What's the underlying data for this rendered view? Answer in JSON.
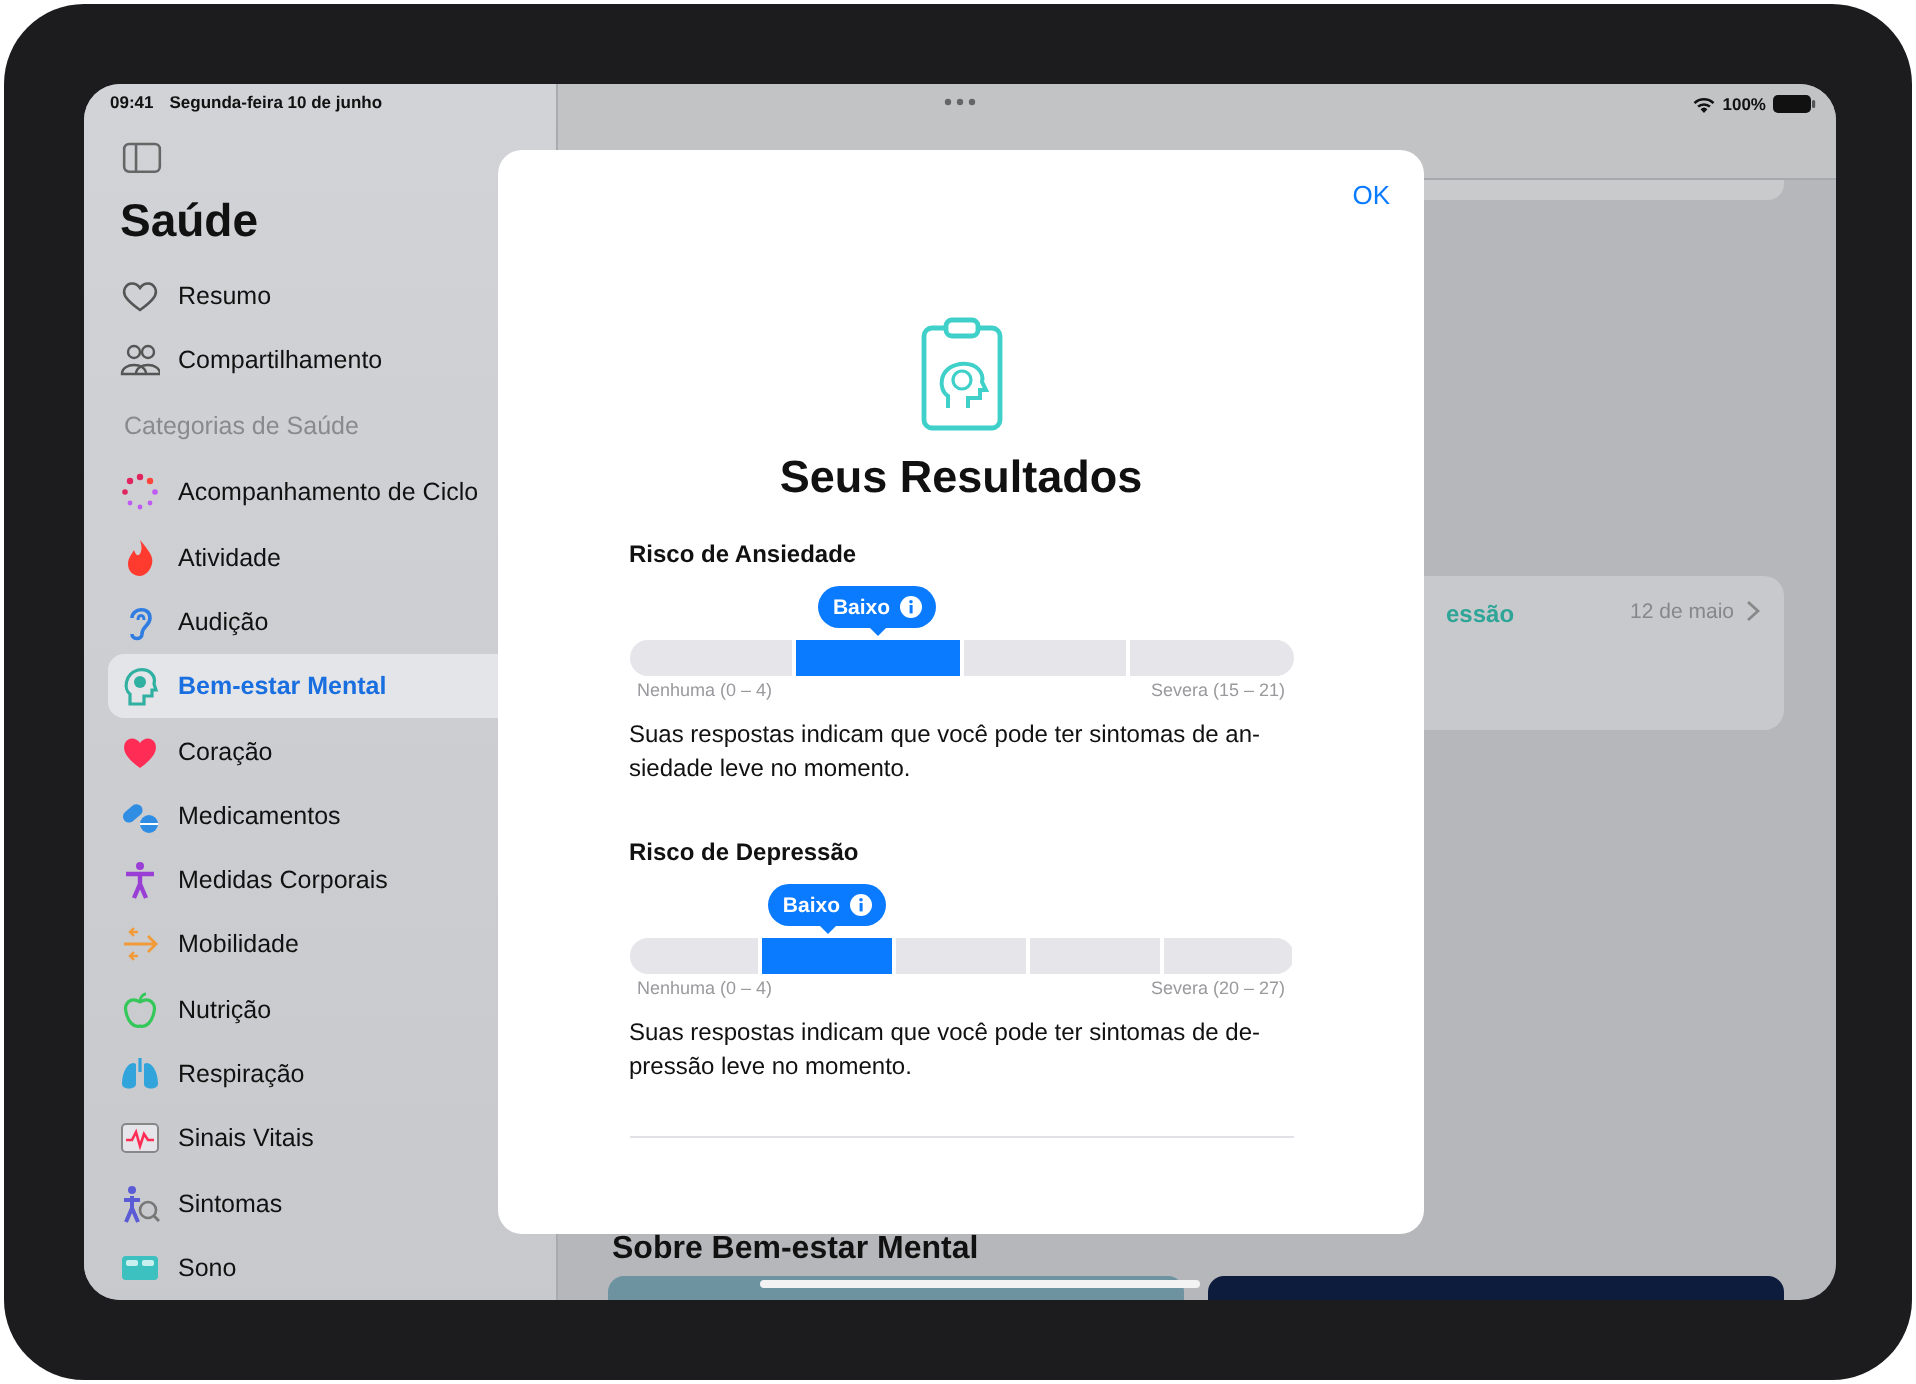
{
  "status_bar": {
    "time": "09:41",
    "date": "Segunda-feira 10 de junho",
    "battery": "100%"
  },
  "sidebar": {
    "title": "Saúde",
    "top_items": [
      {
        "label": "Resumo",
        "selected": false
      },
      {
        "label": "Compartilhamento",
        "selected": false
      }
    ],
    "section_header": "Categorias de Saúde",
    "categories": [
      {
        "label": "Acompanhamento de Ciclo",
        "selected": false
      },
      {
        "label": "Atividade",
        "selected": false
      },
      {
        "label": "Audição",
        "selected": false
      },
      {
        "label": "Bem-estar Mental",
        "selected": true
      },
      {
        "label": "Coração",
        "selected": false
      },
      {
        "label": "Medicamentos",
        "selected": false
      },
      {
        "label": "Medidas Corporais",
        "selected": false
      },
      {
        "label": "Mobilidade",
        "selected": false
      },
      {
        "label": "Nutrição",
        "selected": false
      },
      {
        "label": "Respiração",
        "selected": false
      },
      {
        "label": "Sinais Vitais",
        "selected": false
      },
      {
        "label": "Sintomas",
        "selected": false
      },
      {
        "label": "Sono",
        "selected": false
      }
    ]
  },
  "main": {
    "card": {
      "title": "essão",
      "date": "12 de maio"
    },
    "section_title": "Sobre Bem-estar Mental"
  },
  "modal": {
    "done_button": "OK",
    "title": "Seus Resultados",
    "results": [
      {
        "heading": "Risco de Ansiedade",
        "badge": "Baixo",
        "segments": [
          {
            "selected": false
          },
          {
            "selected": true
          },
          {
            "selected": false
          },
          {
            "selected": false
          }
        ],
        "min_label": "Nenhuma (0 – 4)",
        "max_label": "Severa (15 – 21)",
        "description": "Suas respostas indicam que você pode ter sintomas de an-siedade leve no momento."
      },
      {
        "heading": "Risco de Depressão",
        "badge": "Baixo",
        "segments": [
          {
            "selected": false
          },
          {
            "selected": true
          },
          {
            "selected": false
          },
          {
            "selected": false
          },
          {
            "selected": false
          }
        ],
        "min_label": "Nenhuma (0 – 4)",
        "max_label": "Severa (20 – 27)",
        "description": "Suas respostas indicam que você pode ter sintomas de de-pressão leve no momento."
      }
    ]
  }
}
